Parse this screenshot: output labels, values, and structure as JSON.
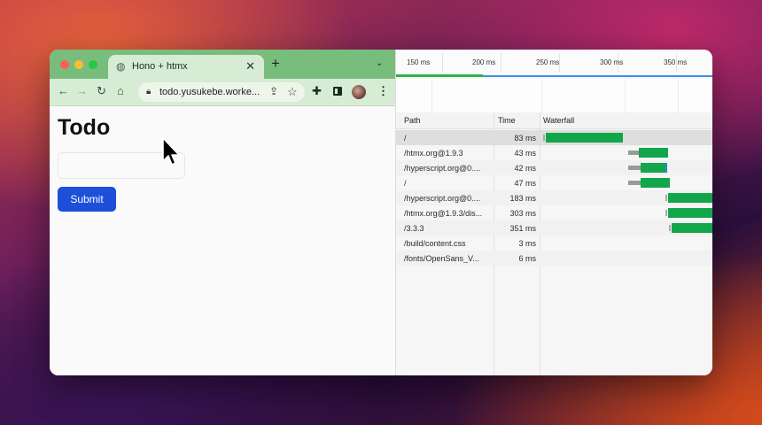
{
  "browser": {
    "tab_title": "Hono + htmx",
    "url": "todo.yusukebe.worke...",
    "icons": [
      "globe-icon",
      "close-icon",
      "plus-icon",
      "chevron-down-icon",
      "back-icon",
      "forward-icon",
      "reload-icon",
      "home-icon",
      "lock-icon",
      "share-icon",
      "star-icon",
      "puzzle-icon",
      "sidebar-icon",
      "avatar",
      "kebab-icon"
    ]
  },
  "page": {
    "heading": "Todo",
    "input_value": "",
    "submit_label": "Submit"
  },
  "devtools": {
    "ruler_ticks": [
      "150 ms",
      "200 ms",
      "250 ms",
      "300 ms",
      "350 ms"
    ],
    "columns": {
      "path": "Path",
      "time": "Time",
      "waterfall": "Waterfall"
    },
    "rows": [
      {
        "path": "/",
        "time": "83 ms",
        "selected": true
      },
      {
        "path": "/htmx.org@1.9.3",
        "time": "43 ms"
      },
      {
        "path": "/hyperscript.org@0....",
        "time": "42 ms"
      },
      {
        "path": "/",
        "time": "47 ms"
      },
      {
        "path": "/hyperscript.org@0....",
        "time": "183 ms"
      },
      {
        "path": "/htmx.org@1.9.3/dis...",
        "time": "303 ms"
      },
      {
        "path": "/3.3.3",
        "time": "351 ms"
      },
      {
        "path": "/build/content.css",
        "time": "3 ms"
      },
      {
        "path": "/fonts/OpenSans_V...",
        "time": "6 ms"
      }
    ],
    "colors": {
      "download": "#12a64a",
      "waiting": "#9a9a9a",
      "selected_row": "#dedede"
    }
  }
}
